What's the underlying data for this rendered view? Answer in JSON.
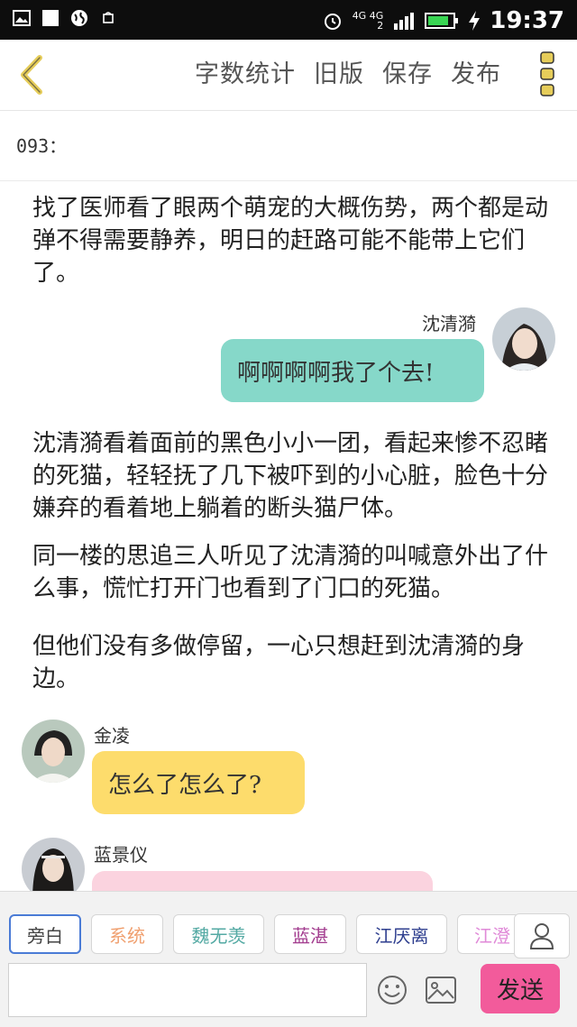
{
  "status_bar": {
    "time": "19:37",
    "network_top": "4G 4G",
    "network_bottom": "2",
    "icons": [
      "image-icon",
      "square-icon",
      "globe-icon",
      "shop-icon",
      "alarm-icon",
      "signal-icon",
      "battery-icon",
      "charging-icon"
    ]
  },
  "toolbar": {
    "back_icon": "chevron-left-icon",
    "word_count": "字数统计",
    "old_version": "旧版",
    "save": "保存",
    "publish": "发布",
    "more_icon": "more-vertical-icon",
    "accent_color": "#e6cd5a"
  },
  "chapter": {
    "title": "093："
  },
  "story": {
    "p1": "找了医师看了眼两个萌宠的大概伤势，两个都是动弹不得需要静养，明日的赶路可能不能带上它们了。",
    "msg1": {
      "speaker": "沈清漪",
      "text": "啊啊啊啊我了个去!",
      "color": "#86d8c9"
    },
    "p2": "沈清漪看着面前的黑色小小一团，看起来惨不忍睹的死猫，轻轻抚了几下被吓到的小心脏，脸色十分嫌弃的看着地上躺着的断头猫尸体。",
    "p3": "同一楼的思追三人听见了沈清漪的叫喊意外出了什么事，慌忙打开门也看到了门口的死猫。",
    "p4": "但他们没有多做停留，一心只想赶到沈清漪的身边。",
    "msg2": {
      "speaker": "金凌",
      "text": "怎么了怎么了?",
      "color": "#fddc6c"
    },
    "msg3": {
      "speaker": "蓝景仪",
      "text": "",
      "color": "#fbd3df"
    }
  },
  "bottom": {
    "roles": [
      {
        "label": "旁白",
        "color": "#444444"
      },
      {
        "label": "系统",
        "color": "#f0a070"
      },
      {
        "label": "魏无羡",
        "color": "#53a9a3"
      },
      {
        "label": "蓝湛",
        "color": "#a23b8e"
      },
      {
        "label": "江厌离",
        "color": "#2f3f8f"
      },
      {
        "label": "江澄",
        "color": "#e08ad8"
      }
    ],
    "user_icon": "user-icon",
    "emoji_icon": "smiley-icon",
    "image_icon": "image-icon",
    "send": "发送",
    "send_color": "#f25b9b"
  }
}
